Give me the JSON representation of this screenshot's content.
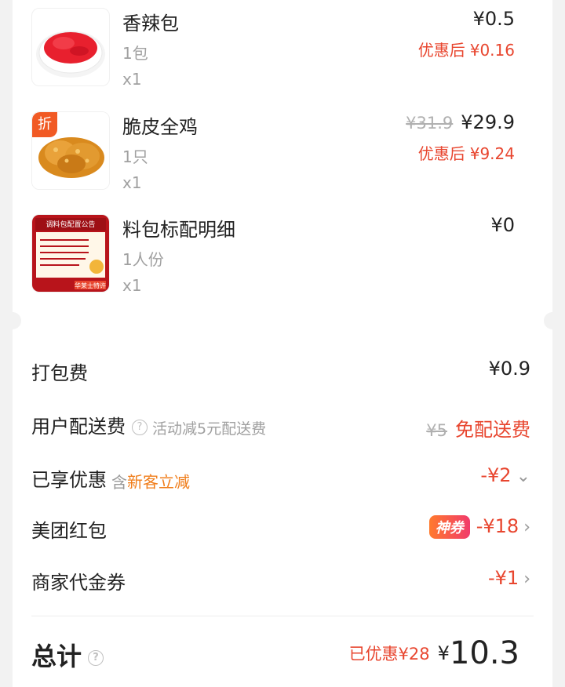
{
  "items": [
    {
      "name": "香辣包",
      "spec": "1包",
      "qty": "x1",
      "price": "¥0.5",
      "orig": "",
      "disc_label": "优惠后",
      "disc_value": "¥0.16",
      "badge": "",
      "thumb_icon": "red-spice-bowl-icon"
    },
    {
      "name": "脆皮全鸡",
      "spec": "1只",
      "qty": "x1",
      "price": "¥29.9",
      "orig": "¥31.9",
      "disc_label": "优惠后",
      "disc_value": "¥9.24",
      "badge": "折",
      "thumb_icon": "fried-chicken-icon"
    },
    {
      "name": "料包标配明细",
      "spec": "1人份",
      "qty": "x1",
      "price": "¥0",
      "orig": "",
      "disc_label": "",
      "disc_value": "",
      "badge": "",
      "thumb_icon": "seasoning-notice-card-icon"
    }
  ],
  "thumb_card": {
    "title": "调料包配置公告",
    "footer": "华莱士特许"
  },
  "fees": {
    "packing": {
      "label": "打包费",
      "value": "¥0.9"
    },
    "delivery": {
      "label": "用户配送费",
      "note": "活动减5元配送费",
      "orig": "¥5",
      "value": "免配送费"
    },
    "discount": {
      "label": "已享优惠",
      "prefix": "含",
      "highlight": "新客立减",
      "value": "-¥2"
    },
    "redpacket": {
      "label": "美团红包",
      "tag": "神券",
      "value": "-¥18"
    },
    "voucher": {
      "label": "商家代金券",
      "value": "-¥1"
    }
  },
  "total": {
    "label": "总计",
    "saved": "已优惠¥28",
    "symbol": "¥",
    "amount": "10.3"
  },
  "colors": {
    "accent": "#e8462f",
    "orange": "#f07d1a",
    "muted": "#a0a0a0"
  }
}
